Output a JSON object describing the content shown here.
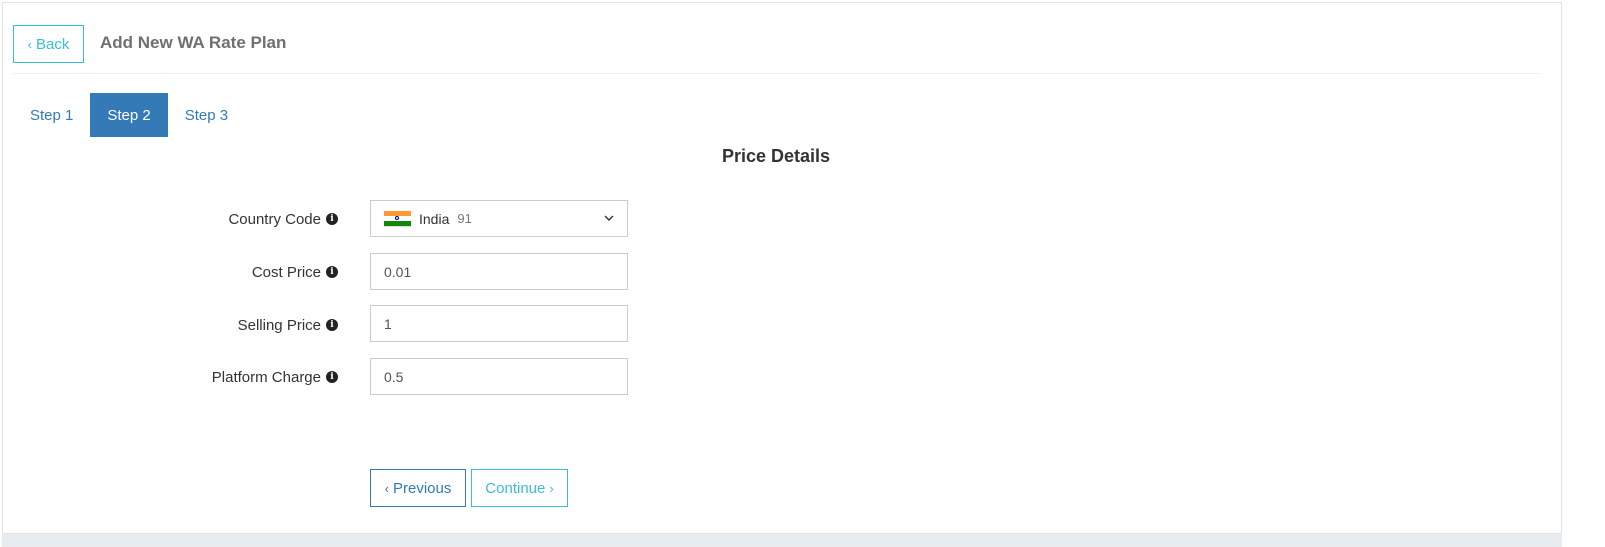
{
  "header": {
    "back_label": "Back",
    "title": "Add New WA Rate Plan"
  },
  "tabs": [
    {
      "label": "Step 1",
      "active": false
    },
    {
      "label": "Step 2",
      "active": true
    },
    {
      "label": "Step 3",
      "active": false
    }
  ],
  "section": {
    "title": "Price Details"
  },
  "form": {
    "country": {
      "label": "Country Code",
      "country_name": "India",
      "dial_code": "91"
    },
    "cost_price": {
      "label": "Cost Price",
      "value": "0.01"
    },
    "selling_price": {
      "label": "Selling Price",
      "value": "1"
    },
    "platform_charge": {
      "label": "Platform Charge",
      "value": "0.5"
    }
  },
  "actions": {
    "previous_label": "Previous",
    "continue_label": "Continue"
  },
  "colors": {
    "primary": "#337ab7",
    "info": "#3bbcd8",
    "footer": "#e9ecef"
  }
}
